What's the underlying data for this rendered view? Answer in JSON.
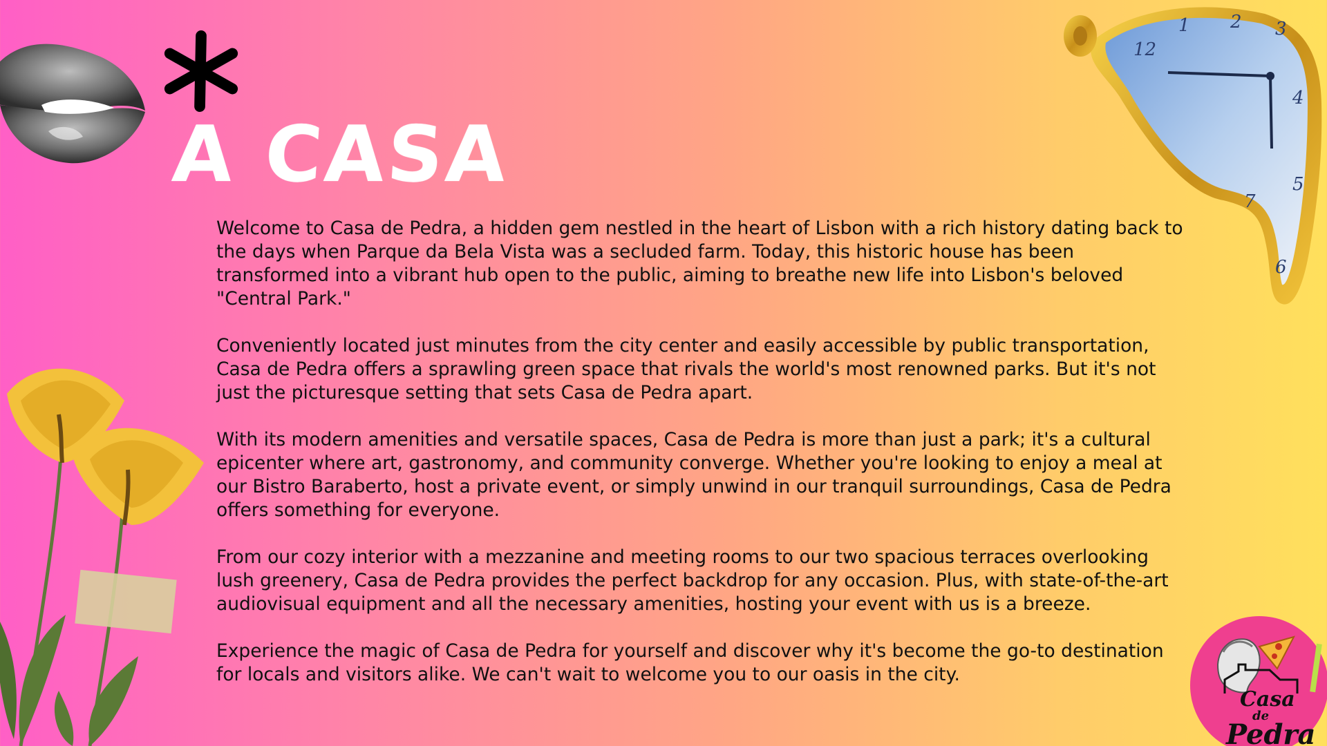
{
  "slide": {
    "title": "A CASA",
    "paragraphs": [
      "Welcome to Casa de Pedra, a hidden gem nestled in the heart of Lisbon with a rich history dating back to the days when Parque da Bela Vista was a secluded farm. Today, this historic house has been transformed into a vibrant hub open to the public, aiming to breathe new life into Lisbon's beloved \"Central Park.\"",
      "Conveniently located just minutes from the city center and easily accessible by public transportation, Casa de Pedra offers a sprawling green space that rivals the world's most renowned parks. But it's not just the picturesque setting that sets Casa de Pedra apart.",
      "With its modern amenities and versatile spaces, Casa de Pedra is more than just a park; it's a cultural epicenter where art, gastronomy, and community converge. Whether you're looking to enjoy a meal at our Bistro Baraberto, host a private event, or simply unwind in our tranquil surroundings, Casa de Pedra offers something for everyone.",
      "From our cozy interior with a mezzanine and meeting rooms to our two spacious terraces overlooking lush greenery, Casa de Pedra provides the perfect backdrop for any occasion. Plus, with state-of-the-art audiovisual equipment and all the necessary amenities, hosting your event with us is a breeze.",
      "Experience the magic of Casa de Pedra for yourself and discover why it's become the go-to destination for locals and visitors alike. We can't wait to welcome you to our oasis in the city."
    ]
  },
  "logo": {
    "line1": "Casa",
    "line2": "de",
    "line3": "Pedra"
  },
  "clock": {
    "numerals": [
      "12",
      "1",
      "2",
      "3",
      "4",
      "5",
      "6",
      "7"
    ]
  },
  "icons": {
    "lips": "lips-icon",
    "asterisk": "asterisk-icon",
    "flowers": "flowers-icon",
    "clock": "melting-clock-icon",
    "logo": "casa-de-pedra-logo"
  },
  "colors": {
    "gradient_start": "#ff5fc6",
    "gradient_end": "#ffe05c",
    "title": "#ffffff",
    "text": "#111111",
    "logo_bg": "#ef3f8f"
  }
}
